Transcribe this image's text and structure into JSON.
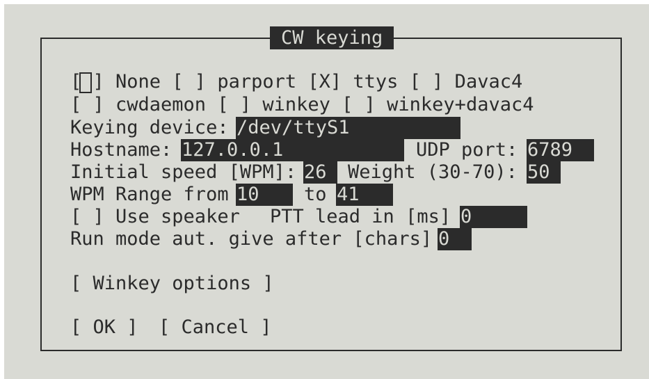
{
  "dialog": {
    "title": "CW keying"
  },
  "keyer_row1": "[ ] None [ ] parport [X] ttys [ ] Davac4",
  "keyer_row2": "[ ] cwdaemon [ ] winkey [ ] winkey+davac4",
  "keying_device": {
    "label": "Keying device:",
    "value": "/dev/ttyS1"
  },
  "hostname": {
    "label": "Hostname:",
    "value": "127.0.0.1"
  },
  "udp_port": {
    "label": "UDP port:",
    "value": "6789"
  },
  "initial_speed": {
    "label": "Initial speed [WPM]:",
    "value": "26"
  },
  "weight": {
    "label": "Weight (30-70):",
    "value": "50"
  },
  "wpm_range": {
    "label": "WPM Range from",
    "from": "10",
    "to_label": "to",
    "to": "41"
  },
  "speaker": {
    "label": "[ ] Use speaker"
  },
  "ptt": {
    "label": "PTT lead in [ms]",
    "value": "0"
  },
  "run_mode": {
    "label": "Run mode aut. give after [chars]",
    "value": "0"
  },
  "buttons": {
    "winkey_options": "[ Winkey options ]",
    "ok": "[ OK ]",
    "cancel": "[ Cancel ]"
  }
}
